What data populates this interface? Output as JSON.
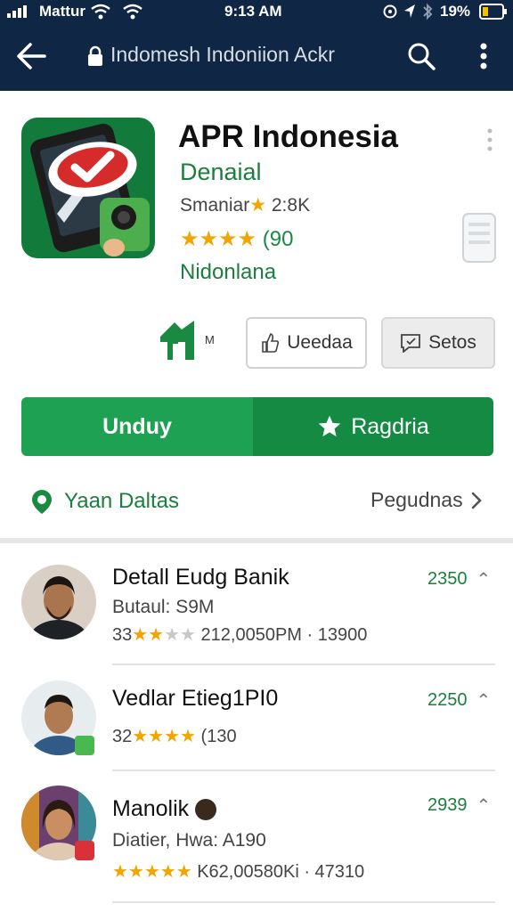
{
  "status_bar": {
    "carrier": "Mattur",
    "time": "9:13 AM",
    "battery": "19%"
  },
  "url_bar": {
    "url": "Indomesh Indoniion Ackr"
  },
  "app": {
    "title": "APR Indonesia",
    "developer": "Denaial",
    "meta_text": "Smaniar",
    "meta_count": "2:8K",
    "rating_text": "(90",
    "region": "Nidonlana",
    "tag_label": "M"
  },
  "buttons": {
    "outline_label": "Ueedaa",
    "grey_label": "Setos",
    "install_label": "Unduy",
    "wishlist_label": "Ragdria"
  },
  "links": {
    "left": "Yaan Daltas",
    "right": "Pegudnas"
  },
  "reviews": [
    {
      "name": "Detall Eudg Banik",
      "sub": "Butaul: S9M",
      "rating_prefix": "33",
      "stars": 2.5,
      "rating_text": "212,0050PM · 13900",
      "count": "2350"
    },
    {
      "name": "Vedlar Etieg1PI0",
      "sub": "",
      "rating_prefix": "32",
      "stars": 4,
      "rating_text": "(130",
      "count": "2250"
    },
    {
      "name": "Manolik",
      "sub": "Diatier, Hwa: A190",
      "rating_prefix": "",
      "stars": 5,
      "rating_text": "K62,00580Ki · 47310",
      "count": "2939"
    }
  ],
  "colors": {
    "header_bg": "#0f2744",
    "accent_green": "#1a8a43",
    "install_green": "#1fa153",
    "wishlist_green": "#158a43",
    "star": "#f0a500"
  }
}
